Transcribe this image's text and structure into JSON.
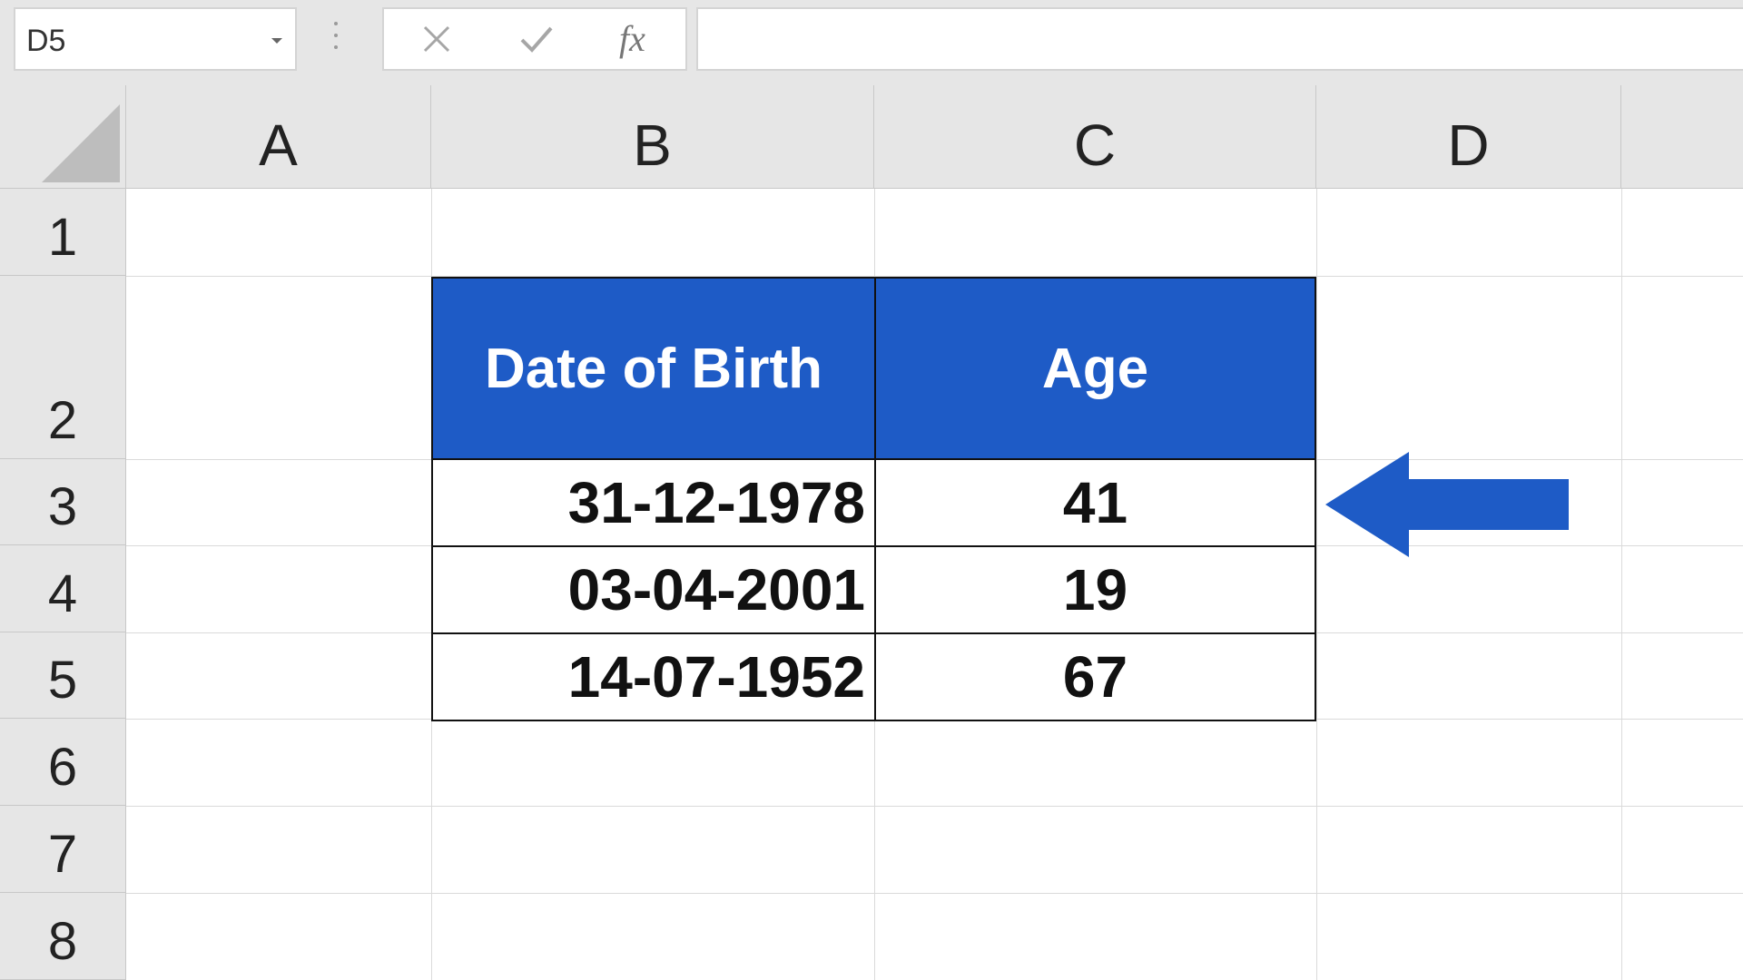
{
  "formula_bar": {
    "name_box": "D5",
    "fx_label": "fx",
    "formula_value": "",
    "cancel_icon": "close-icon",
    "enter_icon": "check-icon"
  },
  "columns": [
    "A",
    "B",
    "C",
    "D"
  ],
  "rows": [
    "1",
    "2",
    "3",
    "4",
    "5",
    "6",
    "7",
    "8"
  ],
  "table": {
    "headers": [
      "Date of Birth",
      "Age"
    ],
    "rows": [
      {
        "dob": "31-12-1978",
        "age": "41"
      },
      {
        "dob": "03-04-2001",
        "age": "19"
      },
      {
        "dob": "14-07-1952",
        "age": "67"
      }
    ]
  },
  "annotation": {
    "arrow_icon": "arrow-left-icon",
    "arrow_color": "#1e5bc6",
    "points_to_row": "3"
  },
  "colors": {
    "header_fill": "#1e5bc6",
    "header_text": "#ffffff",
    "sheet_header_bg": "#e6e6e6"
  }
}
